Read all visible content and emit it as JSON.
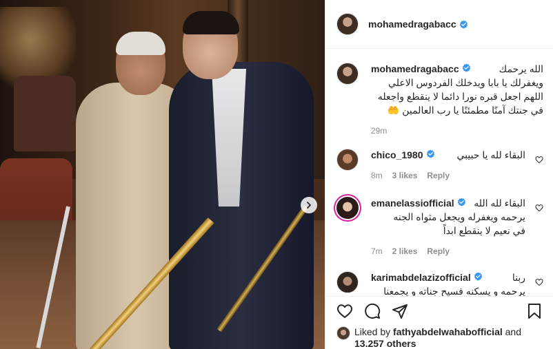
{
  "post": {
    "author": "mohamedragabacc",
    "caption": {
      "username": "mohamedragabacc",
      "text_lines": [
        "الله يرحمك",
        "ويغفرلك يا بابا ويدخلك الفردوس الاعلي",
        "اللهم اجعل قبره نورا دائما لا ينقطع واجعله",
        "في جنتك آمنًا مطمئنًا يا رب العالمين 🤲"
      ],
      "time": "29m"
    },
    "comments": [
      {
        "username": "chico_1980",
        "text_lines": [
          "البقاء لله يا حبيبي"
        ],
        "time": "8m",
        "likes": "3 likes",
        "reply": "Reply"
      },
      {
        "username": "emanelassiofficial",
        "text_lines": [
          "البقاء لله الله",
          "يرحمه ويغفرله ويجعل مثواه الجنه",
          "في نعيم لا ينقطع ابداً"
        ],
        "time": "7m",
        "likes": "2 likes",
        "reply": "Reply"
      },
      {
        "username": "karimabdelazizofficial",
        "text_lines": [
          "ربنا",
          "يرحمه و يسكنه فسيح جناته و يجمعنا"
        ],
        "time": "",
        "likes": "",
        "reply": ""
      }
    ],
    "liked_by": {
      "prefix": "Liked by",
      "username": "fathyabdelwahabofficial",
      "and": "and",
      "others": "13.257 others"
    }
  },
  "icons": {
    "verified": "verified-badge-icon",
    "like": "heart-icon",
    "comment": "comment-icon",
    "share": "share-icon",
    "save": "bookmark-icon",
    "next": "chevron-right-icon"
  },
  "colors": {
    "verified": "#3897f0",
    "border": "#efefef",
    "muted": "#8e8e8e",
    "text": "#262626",
    "story_ring": "#d6249f"
  }
}
